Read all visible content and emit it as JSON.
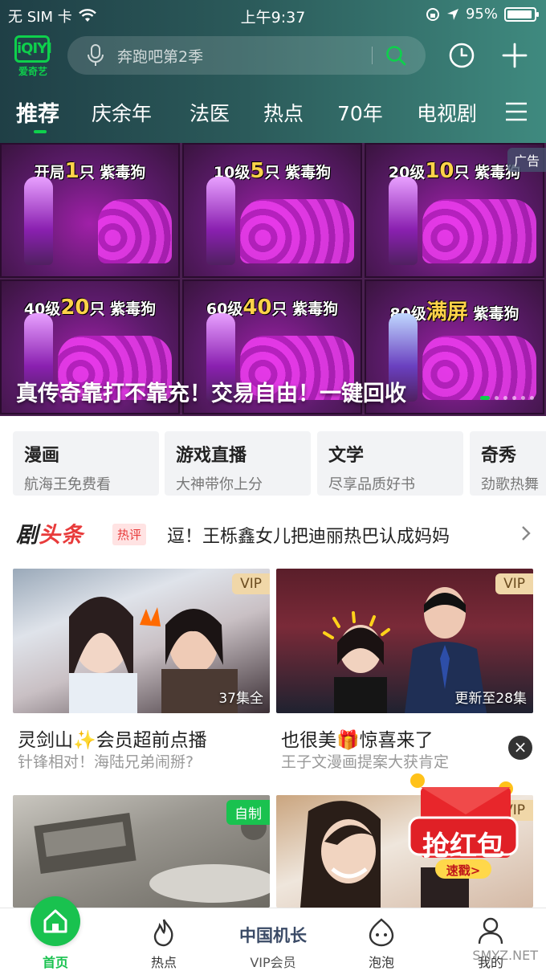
{
  "status_bar": {
    "carrier": "无 SIM 卡",
    "time": "上午9:37",
    "battery": "95%"
  },
  "logo": {
    "mark": "iQIYI",
    "text": "爱奇艺"
  },
  "search": {
    "placeholder": "奔跑吧第2季"
  },
  "tabs": [
    {
      "label": "推荐",
      "active": true
    },
    {
      "label": "庆余年"
    },
    {
      "label": "法医"
    },
    {
      "label": "热点"
    },
    {
      "label": "70年"
    },
    {
      "label": "电视剧"
    }
  ],
  "banner": {
    "ad_label": "广告",
    "caption": "真传奇靠打不靠充！交易自由！一键回收",
    "cells": [
      {
        "pre": "开局",
        "num": "1",
        "post": "只 紫毒狗"
      },
      {
        "pre": "10级",
        "num": "5",
        "post": "只 紫毒狗"
      },
      {
        "pre": "20级",
        "num": "10",
        "post": "只 紫毒狗"
      },
      {
        "pre": "40级",
        "num": "20",
        "post": "只 紫毒狗"
      },
      {
        "pre": "60级",
        "num": "40",
        "post": "只 紫毒狗"
      },
      {
        "pre": "80级",
        "num": "满屏",
        "post": " 紫毒狗"
      }
    ],
    "slide_index": 1,
    "slide_count": 6
  },
  "categories": [
    {
      "title": "漫画",
      "sub": "航海王免费看"
    },
    {
      "title": "游戏直播",
      "sub": "大神带你上分"
    },
    {
      "title": "文学",
      "sub": "尽享品质好书"
    },
    {
      "title": "奇秀",
      "sub": "劲歌热舞"
    }
  ],
  "headline": {
    "logo_a": "剧",
    "logo_b": "头条",
    "badge": "热评",
    "text": "逗！王栎鑫女儿把迪丽热巴认成妈妈"
  },
  "cards": [
    {
      "badge": "VIP",
      "episodes": "37集全",
      "title": "灵剑山✨会员超前点播",
      "desc": "针锋相对！海陆兄弟闹掰?"
    },
    {
      "badge": "VIP",
      "episodes": "更新至28集",
      "title": "也很美🎁惊喜来了",
      "desc": "王子文漫画提案大获肯定"
    },
    {
      "badge": "自制",
      "episodes": "",
      "title": "",
      "desc": ""
    },
    {
      "badge": "VIP",
      "episodes": "",
      "title": "",
      "desc": ""
    }
  ],
  "red_packet": {
    "title": "抢红包",
    "button": "速戳>"
  },
  "bottom_nav": [
    {
      "label": "首页",
      "active": true
    },
    {
      "label": "热点"
    },
    {
      "label": "VIP会员",
      "brand": "中国机长"
    },
    {
      "label": "泡泡"
    },
    {
      "label": "我的"
    }
  ],
  "watermark": "SMYZ.NET",
  "colors": {
    "accent_green": "#0ed04c",
    "header_dark": "#1f3f46",
    "vip_gold": "#f0d7a8",
    "red": "#e83b3b"
  }
}
